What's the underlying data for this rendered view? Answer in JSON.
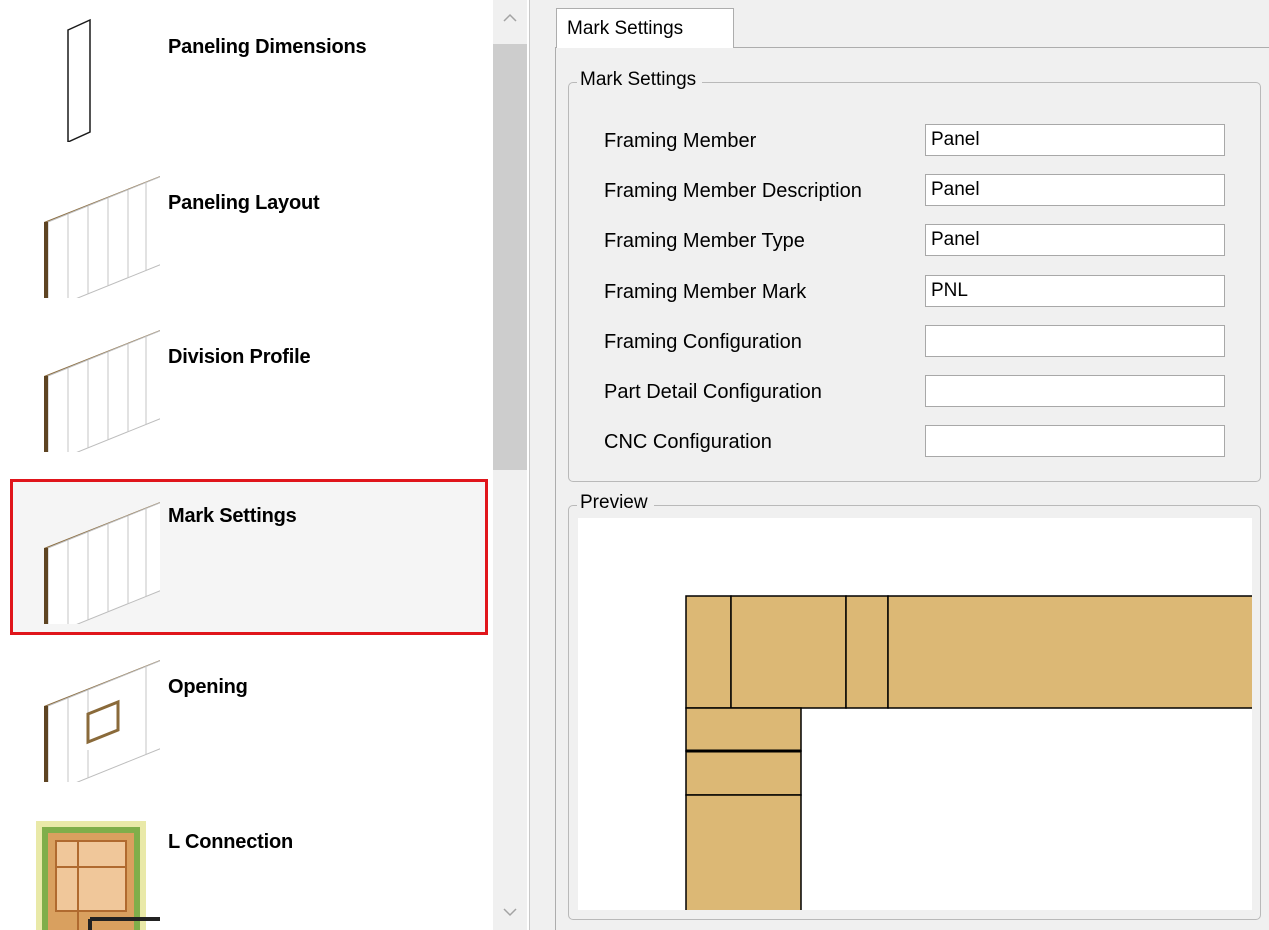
{
  "sidebar": {
    "items": [
      {
        "label": "Paneling Dimensions",
        "icon": "panel-dimensions-icon"
      },
      {
        "label": "Paneling Layout",
        "icon": "paneling-layout-icon"
      },
      {
        "label": "Division Profile",
        "icon": "division-profile-icon"
      },
      {
        "label": "Mark Settings",
        "icon": "mark-settings-icon",
        "selected": true
      },
      {
        "label": "Opening",
        "icon": "opening-icon"
      },
      {
        "label": "L Connection",
        "icon": "l-connection-icon"
      }
    ],
    "scroll_up_icon": "chevron-up-icon",
    "scroll_down_icon": "chevron-down-icon"
  },
  "tabs": [
    {
      "label": "Mark Settings",
      "active": true
    }
  ],
  "mark_settings": {
    "group_title": "Mark Settings",
    "fields": [
      {
        "label": "Framing Member",
        "value": ""
      },
      {
        "label": "Framing Member Description",
        "value": "Panel"
      },
      {
        "label": "Framing Member Type",
        "value": "Panel"
      },
      {
        "label": "Framing Member Mark",
        "value": "PNL"
      },
      {
        "label": "Framing Configuration",
        "value": ""
      },
      {
        "label": "Part Detail Configuration",
        "value": ""
      },
      {
        "label": "CNC Configuration",
        "value": ""
      }
    ]
  },
  "preview": {
    "group_title": "Preview"
  },
  "colors": {
    "selection_border": "#e0151b",
    "wood_fill": "#dcb875",
    "panel_edge": "#7a5a2e"
  }
}
